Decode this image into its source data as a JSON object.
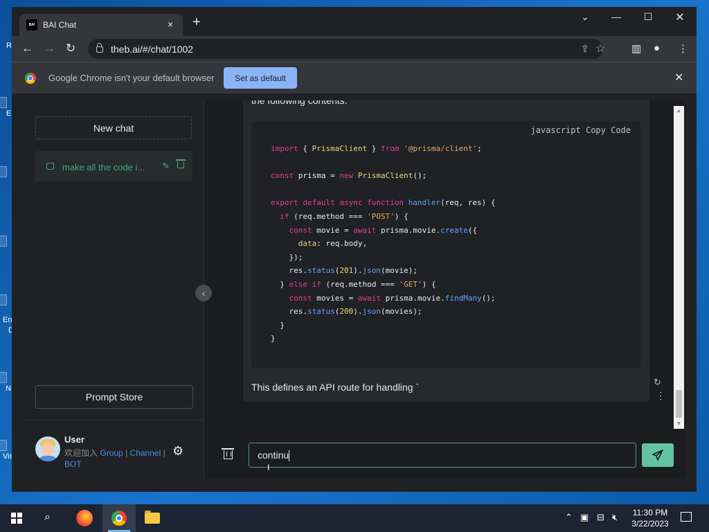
{
  "desktop": {
    "edge_labels": [
      "R",
      "E",
      "En",
      "D",
      "N",
      "Vis"
    ]
  },
  "browser": {
    "tab_title": "BAI Chat",
    "tab_favicon_text": "BAI",
    "tab_close": "×",
    "new_tab": "+",
    "url": "theb.ai/#/chat/1002",
    "infobar_text": "Google Chrome isn't your default browser",
    "set_default_label": "Set as default"
  },
  "sidebar": {
    "new_chat_label": "New chat",
    "chat_items": [
      {
        "label": "make all the code i..."
      }
    ],
    "prompt_store_label": "Prompt Store",
    "user": {
      "name": "User",
      "welcome_prefix": "欢迎加入",
      "link_group": "Group",
      "link_channel": "Channel",
      "link_bot": "BOT",
      "separator": "|"
    }
  },
  "conversation": {
    "top_text": "the following contents:",
    "code_language": "javascript",
    "copy_code_label": "Copy Code",
    "bottom_text": "This defines an API route for handling `"
  },
  "composer": {
    "input_value": "continu"
  },
  "taskbar": {
    "time": "11:30 PM",
    "date": "3/22/2023"
  },
  "colors": {
    "accent_green": "#4e9f85",
    "send_button": "#63c3a1",
    "link_blue": "#4d8ef0",
    "set_default_blue": "#8ab4f8"
  }
}
